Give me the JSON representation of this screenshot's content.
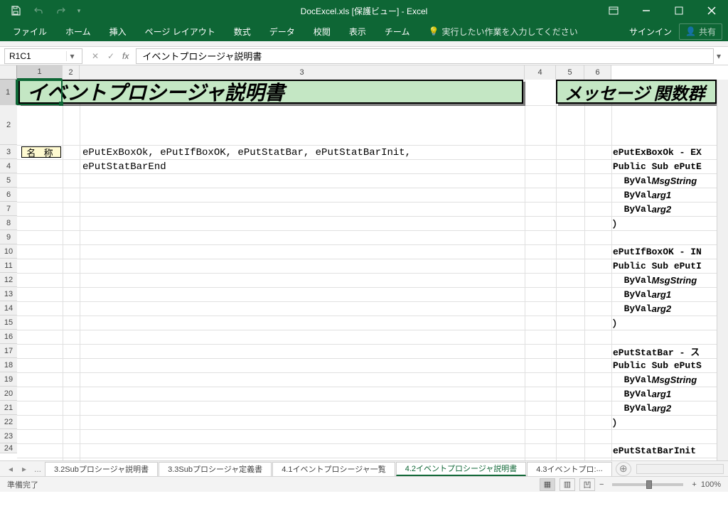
{
  "titlebar": {
    "title": "DocExcel.xls [保護ビュー] - Excel"
  },
  "ribbon": {
    "tabs": [
      "ファイル",
      "ホーム",
      "挿入",
      "ページ レイアウト",
      "数式",
      "データ",
      "校閲",
      "表示",
      "チーム"
    ],
    "tellme": "実行したい作業を入力してください",
    "signin": "サインイン",
    "share": "共有"
  },
  "formula": {
    "namebox": "R1C1",
    "content": "イベントプロシージャ説明書"
  },
  "columns": [
    "1",
    "2",
    "3",
    "4",
    "5",
    "6"
  ],
  "rows": [
    "1",
    "2",
    "3",
    "4",
    "5",
    "6",
    "7",
    "8",
    "9",
    "10",
    "11",
    "12",
    "13",
    "14",
    "15",
    "16",
    "17",
    "18",
    "19",
    "20",
    "21",
    "22",
    "23",
    "24"
  ],
  "selected_cell": "R1C1",
  "main": {
    "title": "イベントプロシージャ説明書",
    "label_name": "名 称",
    "line1": "ePutExBoxOk, ePutIfBoxOK, ePutStatBar, ePutStatBarInit,",
    "line2": "ePutStatBarEnd"
  },
  "side": {
    "title": "メッセージ 関数群",
    "blocks": [
      {
        "head": "ePutExBoxOk - EX",
        "sub": "Public Sub ePutE",
        "args": [
          "ByVal MsgString",
          "ByVal arg1",
          "ByVal arg2",
          "）"
        ]
      },
      {
        "head": "ePutIfBoxOK - IN",
        "sub": "Public Sub ePutI",
        "args": [
          "ByVal MsgString",
          "ByVal arg1",
          "ByVal arg2",
          "）"
        ]
      },
      {
        "head": "ePutStatBar - ス",
        "sub": "Public Sub ePutS",
        "args": [
          "ByVal MsgString",
          "ByVal arg1",
          "ByVal arg2",
          "）"
        ]
      },
      {
        "head": "ePutStatBarInit",
        "sub": "",
        "args": []
      }
    ]
  },
  "tabs": {
    "items": [
      "3.2Subプロシージャ説明書",
      "3.3Subプロシージャ定義書",
      "4.1イベントプロシージャ一覧",
      "4.2イベントプロシージャ説明書",
      "4.3イベントプロ:"
    ],
    "active_index": 3,
    "ellipsis": "...",
    "more": "..."
  },
  "status": {
    "ready": "準備完了",
    "zoom": "100%",
    "minus": "−",
    "plus": "+"
  }
}
